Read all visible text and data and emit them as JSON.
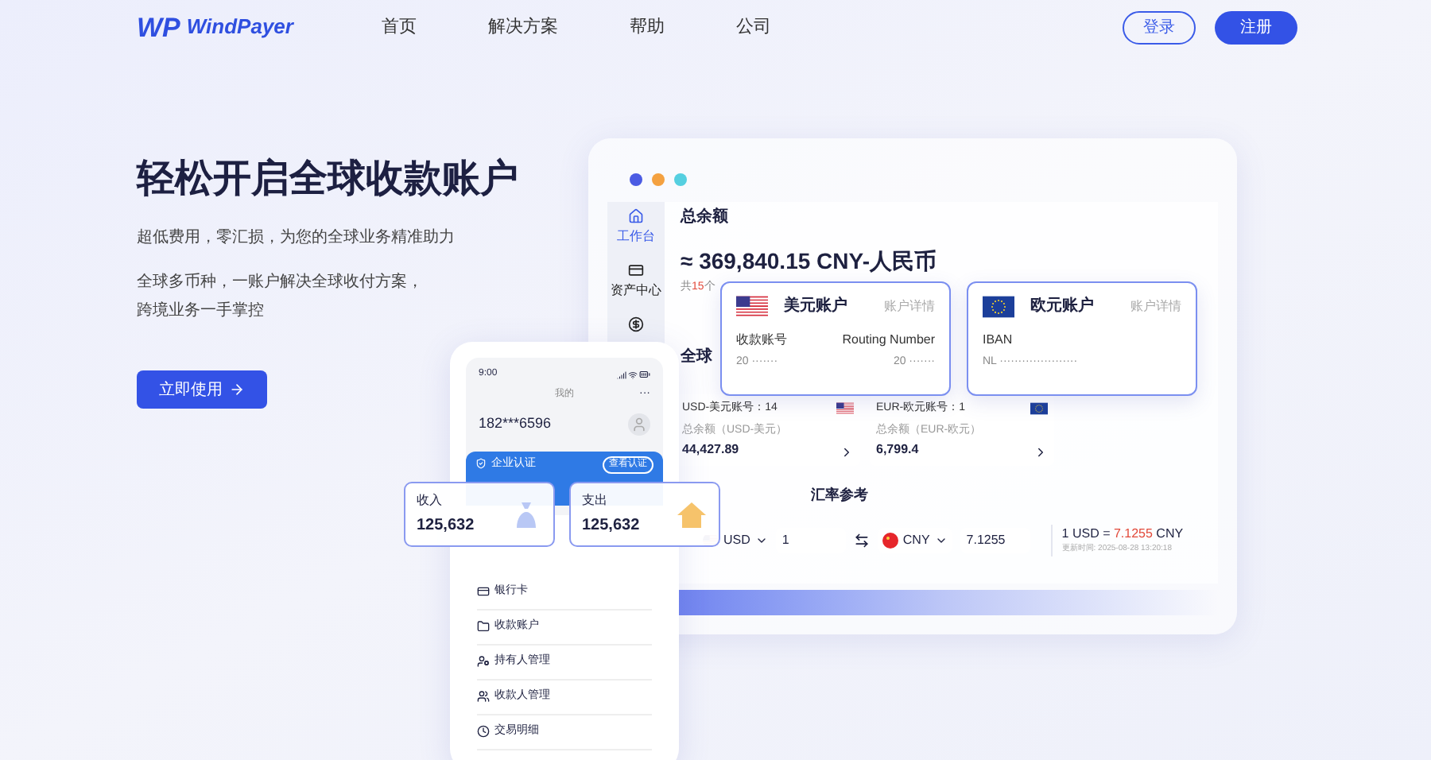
{
  "nav": {
    "logo_mark": "WP",
    "logo_text": "WindPayer",
    "links": [
      {
        "label": "首页"
      },
      {
        "label": "解决方案"
      },
      {
        "label": "帮助"
      },
      {
        "label": "公司"
      }
    ],
    "login": "登录",
    "register": "注册"
  },
  "hero": {
    "title": "轻松开启全球收款账户",
    "subtitle": "超低费用，零汇损，为您的全球业务精准助力",
    "description": [
      "全球多币种，一账户解决全球收付方案，",
      "跨境业务一手掌控"
    ],
    "cta": "立即使用"
  },
  "dashboard": {
    "sidebar": [
      {
        "label": "工作台",
        "selected": true
      },
      {
        "label": "资产中心",
        "selected": false
      },
      {
        "selected": false
      }
    ],
    "balance_label": "总余额",
    "balance": "≈ 369,840.15 CNY-人民币",
    "currency_count": {
      "prefix": "共",
      "count": "15",
      "suffix": "个"
    },
    "currencies_title": "全球",
    "currencies": [
      {
        "kind": "us",
        "account": "USD-美元账号：14",
        "total_label": "总余额（USD-美元）",
        "total": "44,427.89"
      },
      {
        "kind": "eu",
        "account": "EUR-欧元账号：1",
        "total_label": "总余额（EUR-欧元）",
        "total": "6,799.4"
      }
    ],
    "rates_title": "汇率参考",
    "converter": {
      "from_currency": "USD",
      "from_amount": "1",
      "to_currency": "CNY",
      "to_amount": "7.1255",
      "rate_prefix": "1 USD = ",
      "rate_value": "7.1255",
      "rate_suffix": " CNY",
      "updated": "更新时间: 2025-08-28 13:20:18"
    }
  },
  "accounts": [
    {
      "kind": "us",
      "title": "美元账户",
      "link": "账户详情",
      "fields": [
        {
          "label": "收款账号",
          "value": "20 ·······"
        },
        {
          "label": "Routing Number",
          "value": "20 ·······"
        }
      ]
    },
    {
      "kind": "eu",
      "title": "欧元账户",
      "link": "账户详情",
      "fields": [
        {
          "label": "IBAN",
          "value": "NL ·····················"
        }
      ]
    }
  ],
  "phone": {
    "time": "9:00",
    "title": "我的",
    "more": "···",
    "user": "182***6596",
    "verify": "企业认证",
    "verify_button": "查看认证",
    "menu": [
      {
        "label": "银行卡"
      },
      {
        "label": "收款账户"
      },
      {
        "label": "持有人管理"
      },
      {
        "label": "收款人管理"
      },
      {
        "label": "交易明细"
      }
    ]
  },
  "stats": [
    {
      "kind": "income",
      "label": "收入",
      "value": "125,632"
    },
    {
      "kind": "expense",
      "label": "支出",
      "value": "125,632"
    }
  ]
}
